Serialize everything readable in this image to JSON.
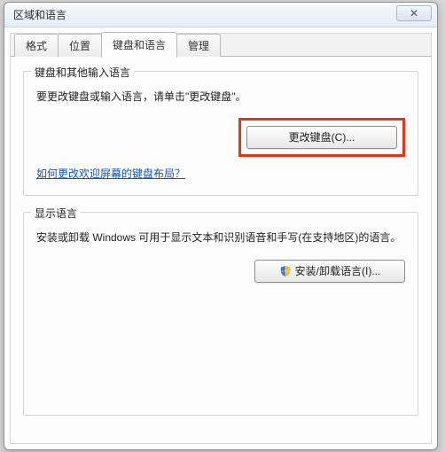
{
  "window": {
    "title": "区域和语言",
    "close_glyph": "✕"
  },
  "tabs": {
    "items": [
      {
        "label": "格式"
      },
      {
        "label": "位置"
      },
      {
        "label": "键盘和语言"
      },
      {
        "label": "管理"
      }
    ],
    "active_index": 2
  },
  "keyboard_group": {
    "title": "键盘和其他输入语言",
    "desc": "要更改键盘或输入语言，请单击\"更改键盘\"。",
    "change_button": "更改键盘(C)...",
    "link": "如何更改欢迎屏幕的键盘布局？"
  },
  "display_group": {
    "title": "显示语言",
    "desc": "安装或卸载 Windows 可用于显示文本和识别语音和手写(在支持地区)的语言。",
    "install_button": "安装/卸载语言(I)..."
  }
}
